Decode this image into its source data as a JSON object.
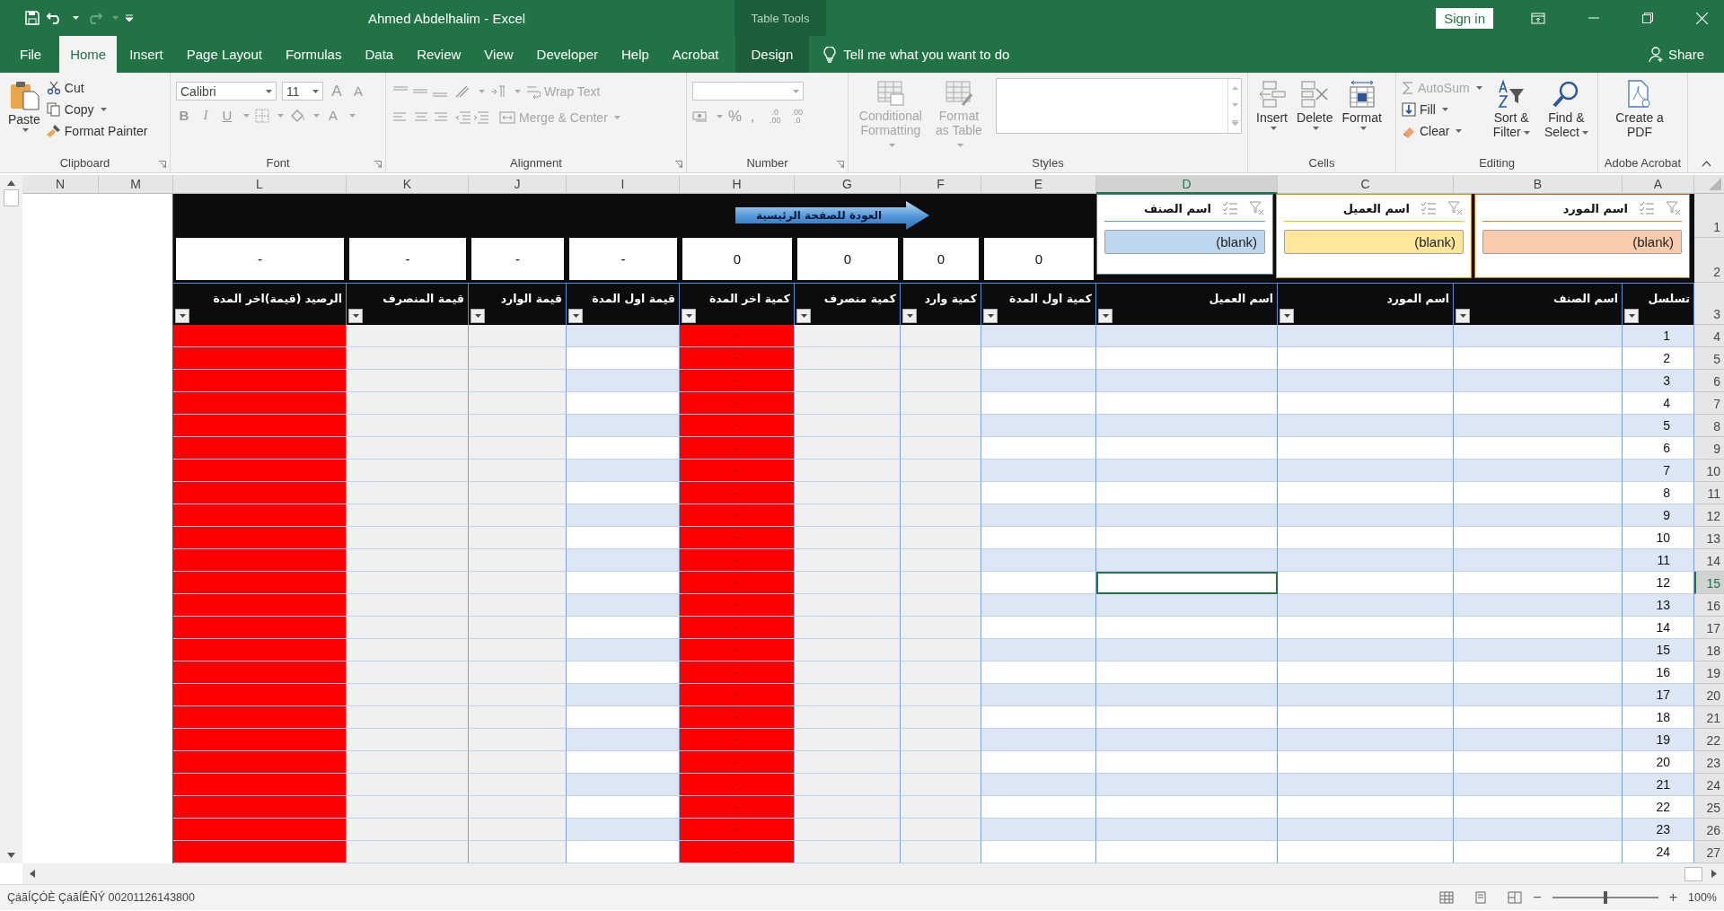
{
  "title_bar": {
    "document_title": "Ahmed Abdelhalim  -  Excel",
    "context_label": "Table Tools",
    "sign_in": "Sign in"
  },
  "tabs": [
    {
      "label": "File",
      "selected": false,
      "kind": "normal"
    },
    {
      "label": "Home",
      "selected": true,
      "kind": "normal"
    },
    {
      "label": "Insert",
      "selected": false,
      "kind": "normal"
    },
    {
      "label": "Page Layout",
      "selected": false,
      "kind": "normal"
    },
    {
      "label": "Formulas",
      "selected": false,
      "kind": "normal"
    },
    {
      "label": "Data",
      "selected": false,
      "kind": "normal"
    },
    {
      "label": "Review",
      "selected": false,
      "kind": "normal"
    },
    {
      "label": "View",
      "selected": false,
      "kind": "normal"
    },
    {
      "label": "Developer",
      "selected": false,
      "kind": "normal"
    },
    {
      "label": "Help",
      "selected": false,
      "kind": "normal"
    },
    {
      "label": "Acrobat",
      "selected": false,
      "kind": "normal"
    },
    {
      "label": "Design",
      "selected": false,
      "kind": "contextual"
    }
  ],
  "tell_me": "Tell me what you want to do",
  "share": "Share",
  "ribbon": {
    "clipboard": {
      "label": "Clipboard",
      "paste": "Paste",
      "items": [
        {
          "label": "Cut",
          "kind": "cut"
        },
        {
          "label": "Copy",
          "kind": "copy"
        },
        {
          "label": "Format Painter",
          "kind": "painter"
        }
      ]
    },
    "font": {
      "label": "Font",
      "font_name": "Calibri",
      "font_size": "11",
      "grow": "A",
      "shrink": "A",
      "styles": [
        "B",
        "I",
        "U"
      ],
      "font_color": "A"
    },
    "alignment": {
      "label": "Alignment",
      "wrap_text": {
        "label": "Wrap Text",
        "disabled": true
      },
      "merge": {
        "label": "Merge & Center",
        "disabled": true
      }
    },
    "number": {
      "label": "Number",
      "symbols": [
        "%",
        ","
      ],
      "decimals": [
        {
          "top": ".0",
          "bottom": ".00"
        },
        {
          "top": ".00",
          "bottom": ".0"
        }
      ]
    },
    "styles": {
      "label": "Styles",
      "buttons": [
        {
          "label": "Conditional Formatting",
          "disabled": true
        },
        {
          "label": "Format as Table",
          "disabled": true
        }
      ]
    },
    "cells": {
      "label": "Cells",
      "buttons": [
        {
          "label": "Insert",
          "kind": "insert"
        },
        {
          "label": "Delete",
          "kind": "delete"
        },
        {
          "label": "Format",
          "kind": "format"
        }
      ]
    },
    "editing": {
      "label": "Editing",
      "items": [
        {
          "label": "AutoSum",
          "kind": "sum",
          "disabled": true
        },
        {
          "label": "Fill",
          "kind": "fill",
          "disabled": false
        },
        {
          "label": "Clear",
          "kind": "clear",
          "disabled": false
        }
      ],
      "buttons": [
        {
          "label": "Sort & Filter",
          "kind": "sort"
        },
        {
          "label": "Find & Select",
          "kind": "find"
        }
      ]
    },
    "acrobat": {
      "label": "Adobe Acrobat",
      "button": "Create a PDF"
    }
  },
  "sheet": {
    "columns": [
      {
        "label": "N",
        "selected": false
      },
      {
        "label": "M",
        "selected": false
      },
      {
        "label": "L",
        "selected": false
      },
      {
        "label": "K",
        "selected": false
      },
      {
        "label": "J",
        "selected": false
      },
      {
        "label": "I",
        "selected": false
      },
      {
        "label": "H",
        "selected": false
      },
      {
        "label": "G",
        "selected": false
      },
      {
        "label": "F",
        "selected": false
      },
      {
        "label": "E",
        "selected": false
      },
      {
        "label": "D",
        "selected": true
      },
      {
        "label": "C",
        "selected": false
      },
      {
        "label": "B",
        "selected": false
      },
      {
        "label": "A",
        "selected": false
      }
    ],
    "top_rows": [
      "1",
      "2",
      "3"
    ],
    "back_button": "العودة للصفحة الرئيسية",
    "slicers": {
      "B": {
        "title": "اسم المورد",
        "item": "(blank)",
        "color": "#ed7d31"
      },
      "C": {
        "title": "اسم العميل",
        "item": "(blank)",
        "color": "#ffc000"
      },
      "D": {
        "title": "اسم الصنف",
        "item": "(blank)",
        "color": "#5b9bd5"
      }
    },
    "totals": [
      "-",
      "-",
      "-",
      "-",
      "0",
      "0",
      "0",
      "0"
    ],
    "headers": [
      {
        "label": "تسلسل",
        "kind": "sequence"
      },
      {
        "label": "اسم الصنف",
        "kind": "banded"
      },
      {
        "label": "اسم المورد",
        "kind": "banded"
      },
      {
        "label": "اسم العميل",
        "kind": "banded"
      },
      {
        "label": "كمية اول المدة",
        "kind": "banded"
      },
      {
        "label": "كمية وارد",
        "kind": "grey"
      },
      {
        "label": "كمية منصرف",
        "kind": "grey"
      },
      {
        "label": "كمية اخر المدة",
        "kind": "red_qty"
      },
      {
        "label": "قيمة اول المدة",
        "kind": "banded"
      },
      {
        "label": "قيمة الوارد",
        "kind": "grey"
      },
      {
        "label": "قيمة المنصرف",
        "kind": "grey"
      },
      {
        "label": "الرصيد (قيمة)اخر المدة",
        "kind": "red"
      }
    ],
    "rows": [
      {
        "number": "4",
        "seq": "1",
        "closing_qty": "-",
        "selected": false
      },
      {
        "number": "5",
        "seq": "2",
        "closing_qty": "-",
        "selected": false
      },
      {
        "number": "6",
        "seq": "3",
        "closing_qty": "-",
        "selected": false
      },
      {
        "number": "7",
        "seq": "4",
        "closing_qty": "-",
        "selected": false
      },
      {
        "number": "8",
        "seq": "5",
        "closing_qty": "-",
        "selected": false
      },
      {
        "number": "9",
        "seq": "6",
        "closing_qty": "-",
        "selected": false
      },
      {
        "number": "10",
        "seq": "7",
        "closing_qty": "-",
        "selected": false
      },
      {
        "number": "11",
        "seq": "8",
        "closing_qty": "-",
        "selected": false
      },
      {
        "number": "12",
        "seq": "9",
        "closing_qty": "-",
        "selected": false
      },
      {
        "number": "13",
        "seq": "10",
        "closing_qty": "-",
        "selected": false
      },
      {
        "number": "14",
        "seq": "11",
        "closing_qty": "-",
        "selected": false
      },
      {
        "number": "15",
        "seq": "12",
        "closing_qty": "-",
        "selected": true
      },
      {
        "number": "16",
        "seq": "13",
        "closing_qty": "-",
        "selected": false
      },
      {
        "number": "17",
        "seq": "14",
        "closing_qty": "-",
        "selected": false
      },
      {
        "number": "18",
        "seq": "15",
        "closing_qty": "-",
        "selected": false
      },
      {
        "number": "19",
        "seq": "16",
        "closing_qty": "-",
        "selected": false
      },
      {
        "number": "20",
        "seq": "17",
        "closing_qty": "-",
        "selected": false
      },
      {
        "number": "21",
        "seq": "18",
        "closing_qty": "-",
        "selected": false
      },
      {
        "number": "22",
        "seq": "19",
        "closing_qty": "-",
        "selected": false
      },
      {
        "number": "23",
        "seq": "20",
        "closing_qty": "-",
        "selected": false
      },
      {
        "number": "24",
        "seq": "21",
        "closing_qty": "-",
        "selected": false
      },
      {
        "number": "25",
        "seq": "22",
        "closing_qty": "-",
        "selected": false
      },
      {
        "number": "26",
        "seq": "23",
        "closing_qty": "-",
        "selected": false
      },
      {
        "number": "27",
        "seq": "24",
        "closing_qty": "-",
        "selected": false
      }
    ]
  },
  "status_bar": {
    "text": "ÇáãÍÇÓÈ ÇáãÍÊÑÝ 00201126143800",
    "zoom_out": "−",
    "zoom_in": "+",
    "zoom": {
      "level": 0.5
    },
    "zoom_label": "100%"
  }
}
